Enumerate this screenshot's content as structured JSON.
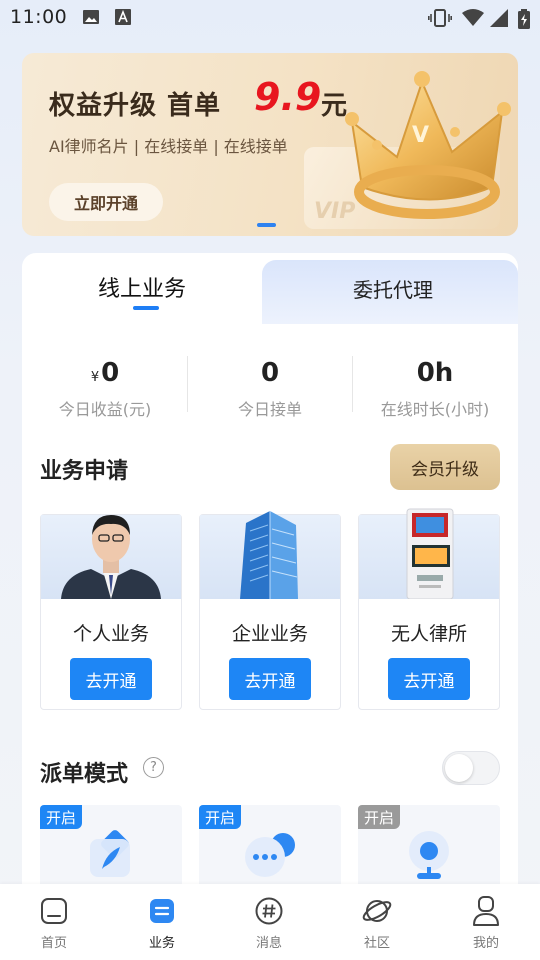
{
  "status_bar": {
    "time": "11:00"
  },
  "banner": {
    "title": "权益升级 首单",
    "price": "9.9",
    "unit": "元",
    "subtitle": "AI律师名片 | 在线接单 | 在线接单",
    "cta": "立即开通",
    "card_text": "VIP"
  },
  "tabs": [
    {
      "label": "线上业务",
      "active": true
    },
    {
      "label": "委托代理",
      "active": false
    }
  ],
  "stats": [
    {
      "currency": "¥",
      "value": "0",
      "label": "今日收益(元)"
    },
    {
      "currency": "",
      "value": "0",
      "label": "今日接单"
    },
    {
      "currency": "",
      "value": "0h",
      "label": "在线时长(小时)"
    }
  ],
  "business": {
    "title": "业务申请",
    "vip_button": "会员升级",
    "items": [
      {
        "name": "个人业务",
        "button": "去开通"
      },
      {
        "name": "企业业务",
        "button": "去开通"
      },
      {
        "name": "无人律所",
        "button": "去开通"
      }
    ]
  },
  "dispatch": {
    "title": "派单模式",
    "help": "?",
    "modes": [
      {
        "tag": "开启",
        "tag_color": "#1e86f5"
      },
      {
        "tag": "开启",
        "tag_color": "#1e86f5"
      },
      {
        "tag": "开启",
        "tag_color": "#9a9a9a"
      }
    ]
  },
  "nav": [
    {
      "label": "首页",
      "icon": "home-icon"
    },
    {
      "label": "业务",
      "icon": "business-icon",
      "active": true
    },
    {
      "label": "消息",
      "icon": "message-icon"
    },
    {
      "label": "社区",
      "icon": "community-icon"
    },
    {
      "label": "我的",
      "icon": "profile-icon"
    }
  ],
  "colors": {
    "accent": "#1e86f5",
    "price": "#e8161f",
    "gold": "#dcc191"
  }
}
